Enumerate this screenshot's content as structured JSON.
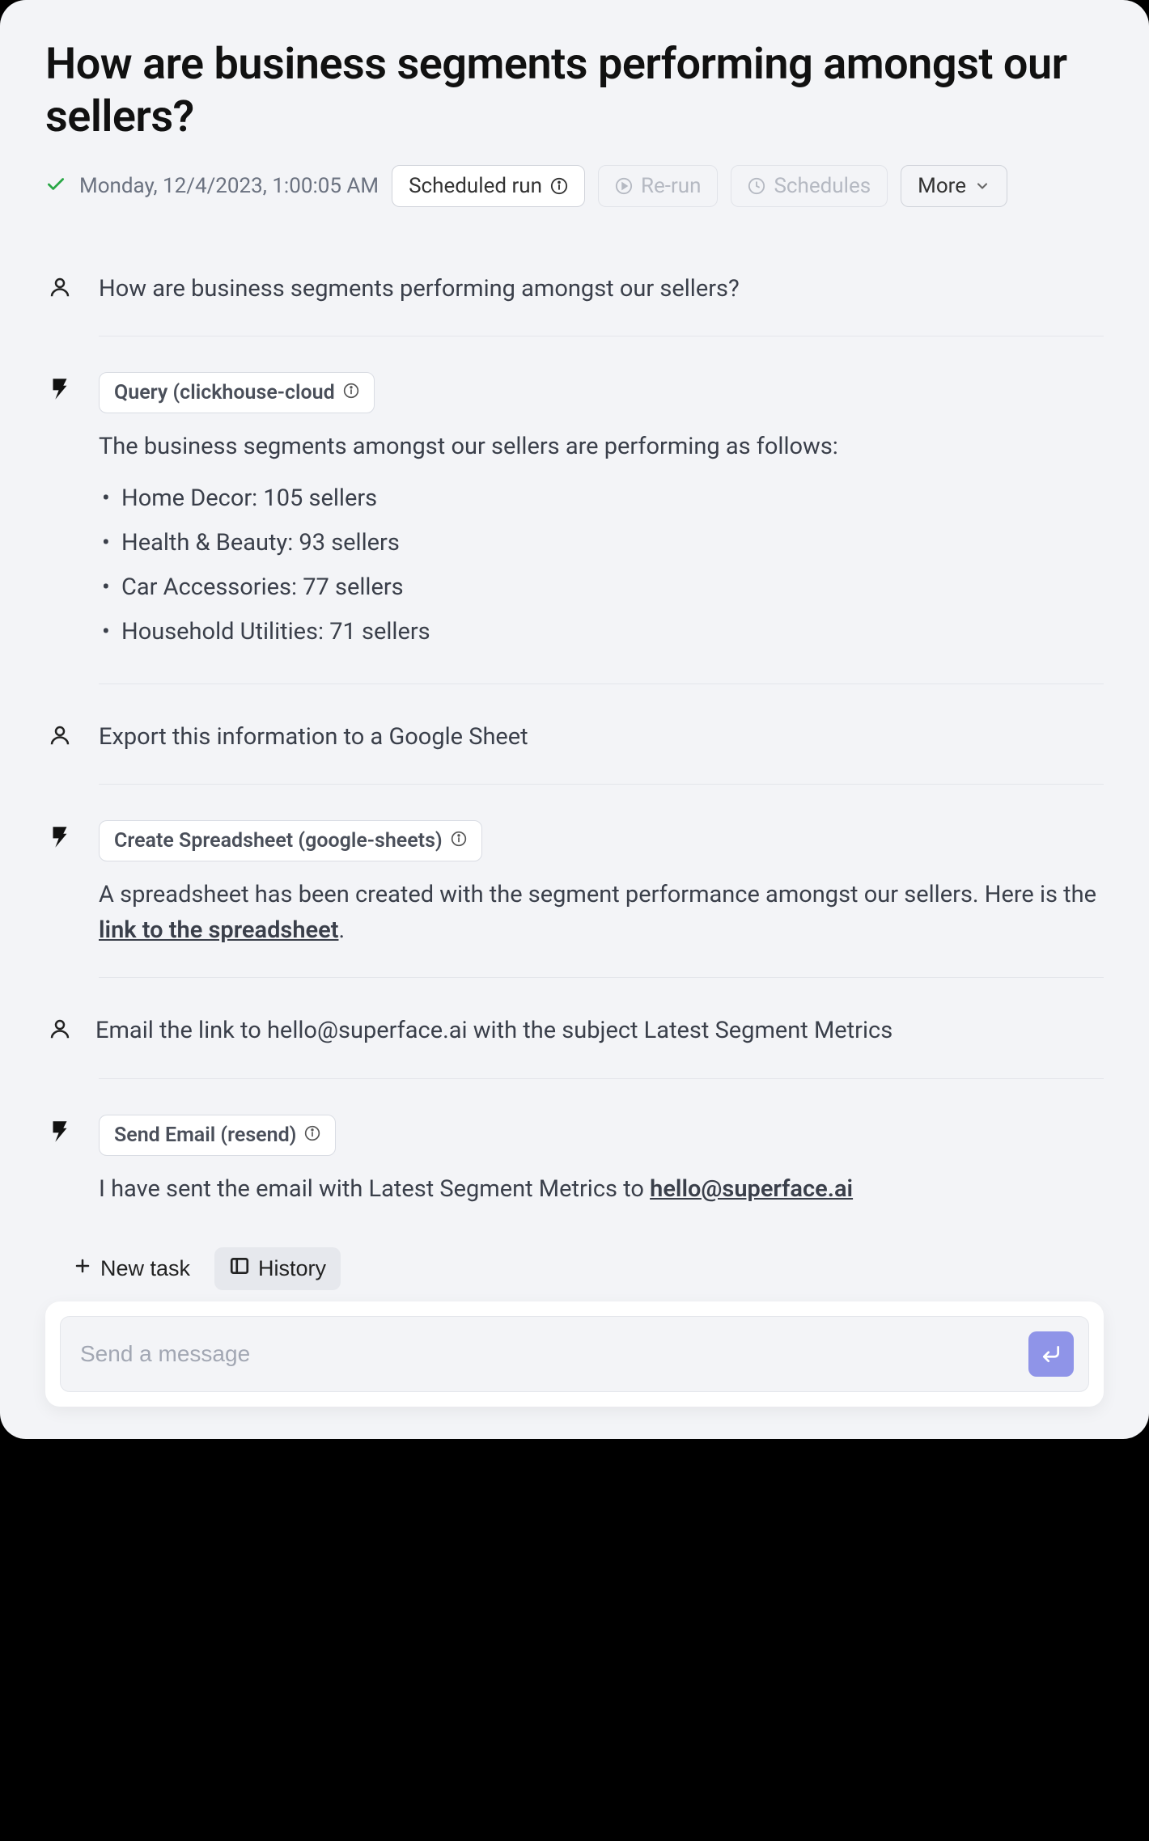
{
  "header": {
    "title": "How are business segments performing amongst our sellers?",
    "timestamp": "Monday, 12/4/2023, 1:00:05 AM",
    "scheduled_label": "Scheduled run",
    "rerun_label": "Re-run",
    "schedules_label": "Schedules",
    "more_label": "More"
  },
  "messages": [
    {
      "role": "user",
      "text": "How are business segments performing amongst our sellers?"
    },
    {
      "role": "assistant",
      "tool": "Query (clickhouse-cloud",
      "intro": "The business segments amongst our sellers are performing as follows:",
      "items": [
        "Home Decor: 105 sellers",
        "Health & Beauty: 93 sellers",
        "Car Accessories: 77 sellers",
        "Household Utilities: 71 sellers"
      ]
    },
    {
      "role": "user",
      "text": "Export this information to a Google Sheet"
    },
    {
      "role": "assistant",
      "tool": "Create Spreadsheet (google-sheets)",
      "text_before": "A spreadsheet has been created with the segment performance amongst our sellers. Here is the ",
      "link_text": "link to the spreadsheet",
      "text_after": "."
    },
    {
      "role": "user",
      "text": "Email the link to hello@superface.ai with the subject Latest Segment Metrics"
    },
    {
      "role": "assistant",
      "tool": "Send Email (resend)",
      "text_before": "I have sent the email with Latest Segment Metrics to ",
      "link_text": "hello@superface.ai",
      "text_after": ""
    }
  ],
  "footer": {
    "new_task": "New task",
    "history": "History",
    "placeholder": "Send a message"
  }
}
